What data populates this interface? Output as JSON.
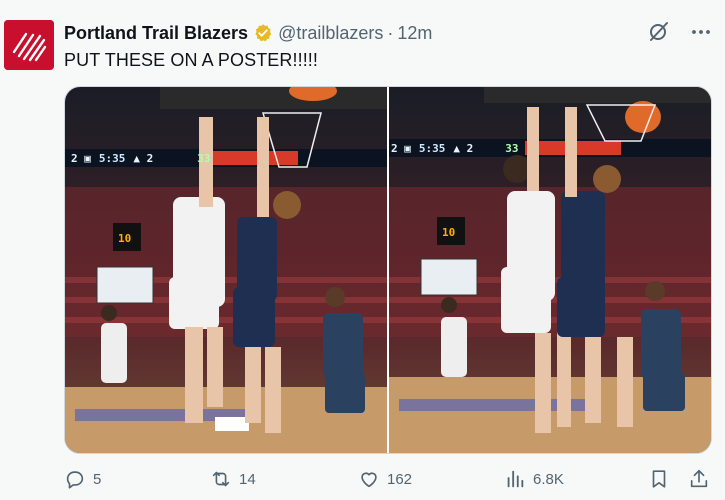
{
  "tweet": {
    "author_name": "Portland Trail Blazers",
    "handle": "@trailblazers",
    "separator": "·",
    "time": "12m",
    "text": "PUT THESE ON A POSTER!!!!!",
    "icons": {
      "avatar": "trail-blazers-logo",
      "verified": "gold-verified-badge",
      "grok": "grok-icon",
      "more": "more-icon"
    }
  },
  "media": {
    "photos": [
      {
        "scoreboard": {
          "clock": "5:35",
          "shot": "33"
        },
        "shot_clock": "10"
      },
      {
        "scoreboard": {
          "clock": "5:35",
          "shot": "33"
        },
        "shot_clock": "10"
      }
    ]
  },
  "actions": {
    "reply_count": "5",
    "repost_count": "14",
    "like_count": "162",
    "view_count": "6.8K"
  },
  "colors": {
    "brand_red": "#c8102e",
    "verified_gold": "#e8b829",
    "text_primary": "#0f1419",
    "text_secondary": "#536471",
    "background": "#f7f9f9"
  }
}
